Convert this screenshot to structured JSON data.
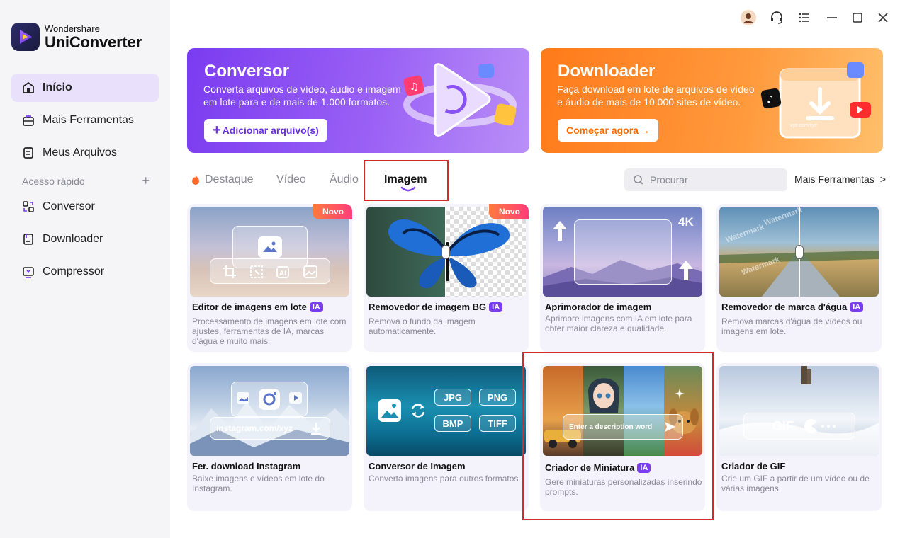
{
  "app": {
    "brand_sub": "Wondershare",
    "brand_main": "UniConverter"
  },
  "sidebar": {
    "items": [
      {
        "label": "Início"
      },
      {
        "label": "Mais Ferramentas"
      },
      {
        "label": "Meus Arquivos"
      }
    ],
    "quick_access_label": "Acesso rápido",
    "quick_items": [
      {
        "label": "Conversor"
      },
      {
        "label": "Downloader"
      },
      {
        "label": "Compressor"
      }
    ]
  },
  "banners": {
    "converter": {
      "title": "Conversor",
      "text": "Converta arquivos de vídeo, áudio e imagem em lote para e de mais de 1.000 formatos.",
      "button": "Adicionar arquivo(s)"
    },
    "downloader": {
      "title": "Downloader",
      "text": "Faça download em lote de arquivos de vídeo e áudio de mais de 10.000 sites de vídeo.",
      "button": "Começar agora",
      "site_text": "xyz.com/xyz"
    }
  },
  "tabs": [
    {
      "label": "Destaque"
    },
    {
      "label": "Vídeo"
    },
    {
      "label": "Áudio"
    },
    {
      "label": "Imagem"
    }
  ],
  "search": {
    "placeholder": "Procurar"
  },
  "more_tools_link": "Mais Ferramentas",
  "badges": {
    "new": "Novo",
    "ai": "IA",
    "res_4k": "4K",
    "watermark": "Watermark"
  },
  "cards": [
    {
      "title": "Editor de imagens em lote",
      "desc": "Processamento de imagens em lote com ajustes, ferramentas de IA, marcas d'água e muito mais."
    },
    {
      "title": "Removedor de imagem BG",
      "desc": "Remova o fundo da imagem automaticamente."
    },
    {
      "title": "Aprimorador de imagem",
      "desc": "Aprimore imagens com IA em lote para obter maior clareza e qualidade."
    },
    {
      "title": "Removedor de marca d'água",
      "desc": "Remova marcas d'água de vídeos ou imagens em lote."
    },
    {
      "title": "Fer. download Instagram",
      "desc": "Baixe imagens e vídeos em lote do Instagram.",
      "url": "instagram.com/xyz"
    },
    {
      "title": "Conversor de Imagem",
      "desc": "Converta imagens para outros formatos",
      "formats": [
        "JPG",
        "PNG",
        "BMP",
        "TIFF"
      ]
    },
    {
      "title": "Criador de Miniatura",
      "desc": "Gere miniaturas personalizadas inserindo prompts.",
      "prompt": "Enter a description word"
    },
    {
      "title": "Criador de GIF",
      "desc": "Crie um GIF a partir de um vídeo ou de várias imagens.",
      "gif_label": "GIF"
    }
  ],
  "colors": {
    "accent": "#7a3cf0",
    "orange": "#ff7a1a",
    "highlight": "#d62b2b"
  }
}
